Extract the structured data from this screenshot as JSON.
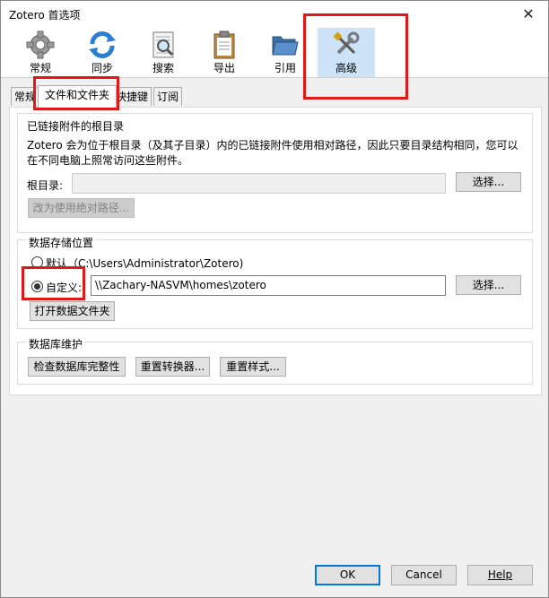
{
  "window": {
    "title": "Zotero 首选项",
    "close_icon": "close-icon"
  },
  "toolbar": {
    "items": [
      {
        "label": "常规",
        "icon": "gear-icon"
      },
      {
        "label": "同步",
        "icon": "sync-icon"
      },
      {
        "label": "搜索",
        "icon": "search-document-icon"
      },
      {
        "label": "导出",
        "icon": "clipboard-icon"
      },
      {
        "label": "引用",
        "icon": "folder-icon"
      },
      {
        "label": "高级",
        "icon": "tools-icon"
      }
    ],
    "selected": "高级"
  },
  "tabs": [
    {
      "label": "常规"
    },
    {
      "label": "文件和文件夹"
    },
    {
      "label": "快捷键"
    },
    {
      "label": "订阅"
    }
  ],
  "linked_attachments": {
    "title": "已链接附件的根目录",
    "description_line1": "Zotero 会为位于根目录（及其子目录）内的已链接附件使用相对路径，因此只要目录结构相同，您可以",
    "description_line2": "在不同电脑上照常访问这些附件。",
    "root_label": "根目录:",
    "root_value": "",
    "choose_button": "选择...",
    "absolute_button": "改为使用绝对路径..."
  },
  "data_storage": {
    "title": "数据存储位置",
    "default_label": "默认（C:\\Users\\Administrator\\Zotero)",
    "custom_label": "自定义:",
    "custom_path": "\\\\Zachary-NASVM\\homes\\zotero",
    "choose_button": "选择...",
    "open_folder_button": "打开数据文件夹"
  },
  "db_maintenance": {
    "title": "数据库维护",
    "check_button": "检查数据库完整性",
    "reset_translators_button": "重置转换器...",
    "reset_styles_button": "重置样式..."
  },
  "dialog": {
    "ok": "OK",
    "cancel": "Cancel",
    "help": "Help"
  },
  "colors": {
    "highlight": "#e01818",
    "selected_toolbar": "#cde3f7",
    "default_button_border": "#0078d7"
  }
}
